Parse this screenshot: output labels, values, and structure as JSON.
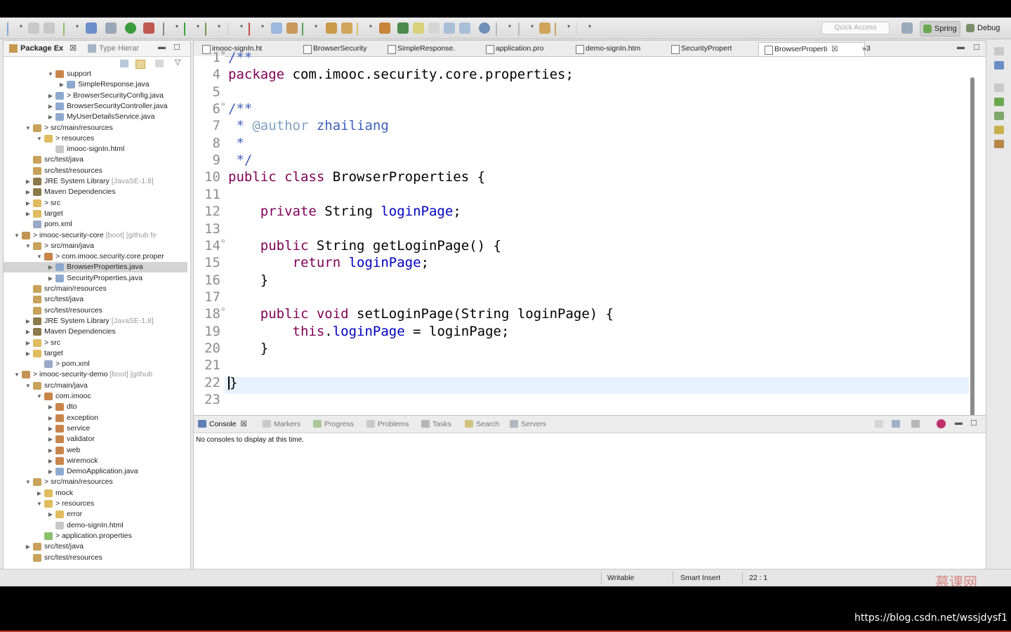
{
  "toolbar": {
    "quick_access_placeholder": "Quick Access",
    "perspectives": [
      {
        "label": "Spring",
        "icon": "spring-leaf-icon",
        "active": true
      },
      {
        "label": "Debug",
        "icon": "bug-icon",
        "active": false
      }
    ]
  },
  "left_panel": {
    "tabs": [
      {
        "label": "Package Ex",
        "icon": "package-explorer-icon",
        "closable": true,
        "active": true
      },
      {
        "label": "Type Hierar",
        "icon": "type-hierarchy-icon",
        "closable": false,
        "active": false
      }
    ],
    "tree": [
      {
        "indent": 4,
        "expanded": true,
        "icon": "package-icon",
        "label": "support"
      },
      {
        "indent": 5,
        "expanded": false,
        "icon": "java-file-icon",
        "label": "SimpleResponse.java"
      },
      {
        "indent": 4,
        "expanded": false,
        "icon": "java-file-icon",
        "label": "> BrowserSecurityConfig.java"
      },
      {
        "indent": 4,
        "expanded": false,
        "icon": "java-file-icon",
        "label": "BrowserSecurityController.java"
      },
      {
        "indent": 4,
        "expanded": false,
        "icon": "java-file-icon",
        "label": "MyUserDetailsService.java"
      },
      {
        "indent": 2,
        "expanded": true,
        "icon": "source-folder-icon",
        "label": "> src/main/resources"
      },
      {
        "indent": 3,
        "expanded": true,
        "icon": "folder-icon",
        "label": "> resources"
      },
      {
        "indent": 4,
        "expanded": null,
        "icon": "html-file-icon",
        "label": "imooc-signIn.html"
      },
      {
        "indent": 2,
        "expanded": null,
        "icon": "source-folder-icon",
        "label": "src/test/java"
      },
      {
        "indent": 2,
        "expanded": null,
        "icon": "source-folder-icon",
        "label": "src/test/resources"
      },
      {
        "indent": 2,
        "expanded": false,
        "icon": "library-icon",
        "label": "JRE System Library",
        "decoration": "[JavaSE-1.8]"
      },
      {
        "indent": 2,
        "expanded": false,
        "icon": "library-icon",
        "label": "Maven Dependencies"
      },
      {
        "indent": 2,
        "expanded": false,
        "icon": "folder-icon",
        "label": "> src"
      },
      {
        "indent": 2,
        "expanded": false,
        "icon": "folder-icon",
        "label": "target"
      },
      {
        "indent": 2,
        "expanded": null,
        "icon": "xml-file-icon",
        "label": "pom.xml"
      },
      {
        "indent": 1,
        "expanded": true,
        "icon": "project-icon",
        "label": "> imooc-security-core",
        "decoration": "[boot] [github fe"
      },
      {
        "indent": 2,
        "expanded": true,
        "icon": "source-folder-icon",
        "label": "> src/main/java"
      },
      {
        "indent": 3,
        "expanded": true,
        "icon": "package-icon",
        "label": "> com.imooc.security.core.proper"
      },
      {
        "indent": 4,
        "expanded": false,
        "icon": "java-file-icon",
        "label": "BrowserProperties.java",
        "selected": true
      },
      {
        "indent": 4,
        "expanded": false,
        "icon": "java-file-icon",
        "label": "SecurityProperties.java"
      },
      {
        "indent": 2,
        "expanded": null,
        "icon": "source-folder-icon",
        "label": "src/main/resources"
      },
      {
        "indent": 2,
        "expanded": null,
        "icon": "source-folder-icon",
        "label": "src/test/java"
      },
      {
        "indent": 2,
        "expanded": null,
        "icon": "source-folder-icon",
        "label": "src/test/resources"
      },
      {
        "indent": 2,
        "expanded": false,
        "icon": "library-icon",
        "label": "JRE System Library",
        "decoration": "[JavaSE-1.8]"
      },
      {
        "indent": 2,
        "expanded": false,
        "icon": "library-icon",
        "label": "Maven Dependencies"
      },
      {
        "indent": 2,
        "expanded": false,
        "icon": "folder-icon",
        "label": "> src"
      },
      {
        "indent": 2,
        "expanded": false,
        "icon": "folder-icon",
        "label": "target"
      },
      {
        "indent": 3,
        "expanded": null,
        "icon": "xml-file-icon",
        "label": "> pom.xml"
      },
      {
        "indent": 1,
        "expanded": true,
        "icon": "project-icon",
        "label": "> imooc-security-demo",
        "decoration": "[boot] [github"
      },
      {
        "indent": 2,
        "expanded": true,
        "icon": "source-folder-icon",
        "label": "src/main/java"
      },
      {
        "indent": 3,
        "expanded": true,
        "icon": "package-icon",
        "label": "com.imooc"
      },
      {
        "indent": 4,
        "expanded": false,
        "icon": "package-icon",
        "label": "dto"
      },
      {
        "indent": 4,
        "expanded": false,
        "icon": "package-icon",
        "label": "exception"
      },
      {
        "indent": 4,
        "expanded": false,
        "icon": "package-icon",
        "label": "service"
      },
      {
        "indent": 4,
        "expanded": false,
        "icon": "package-icon",
        "label": "validator"
      },
      {
        "indent": 4,
        "expanded": false,
        "icon": "package-icon",
        "label": "web"
      },
      {
        "indent": 4,
        "expanded": false,
        "icon": "package-icon",
        "label": "wiremock"
      },
      {
        "indent": 4,
        "expanded": false,
        "icon": "java-file-icon",
        "label": "DemoApplication.java"
      },
      {
        "indent": 2,
        "expanded": true,
        "icon": "source-folder-icon",
        "label": "> src/main/resources"
      },
      {
        "indent": 3,
        "expanded": false,
        "icon": "folder-icon",
        "label": "mock"
      },
      {
        "indent": 3,
        "expanded": true,
        "icon": "folder-icon",
        "label": "> resources"
      },
      {
        "indent": 4,
        "expanded": false,
        "icon": "folder-icon",
        "label": "error"
      },
      {
        "indent": 4,
        "expanded": null,
        "icon": "html-file-icon",
        "label": "demo-signIn.html"
      },
      {
        "indent": 3,
        "expanded": null,
        "icon": "properties-file-icon",
        "label": "> application.properties"
      },
      {
        "indent": 2,
        "expanded": false,
        "icon": "source-folder-icon",
        "label": "src/test/java"
      },
      {
        "indent": 2,
        "expanded": null,
        "icon": "source-folder-icon",
        "label": "src/test/resources"
      }
    ]
  },
  "editor": {
    "tabs": [
      {
        "label": "imooc-signIn.ht",
        "active": false
      },
      {
        "label": "BrowserSecurity",
        "active": false
      },
      {
        "label": "SimpleResponse.",
        "active": false
      },
      {
        "label": "application.pro",
        "active": false
      },
      {
        "label": "demo-signIn.htm",
        "active": false
      },
      {
        "label": "SecurityPropert",
        "active": false
      },
      {
        "label": "BrowserProperti",
        "active": true,
        "closable": true
      }
    ],
    "overflow_label": "»3",
    "lines": [
      {
        "n": "1",
        "fold": "⊕",
        "html": "<span class='cm'>/**</span>"
      },
      {
        "n": "4",
        "html": "<span class='kw'>package</span> com.imooc.security.core.properties;"
      },
      {
        "n": "5",
        "html": ""
      },
      {
        "n": "6",
        "fold": "⊖",
        "html": "<span class='cm'>/**</span>"
      },
      {
        "n": "7",
        "html": "<span class='cm'> * </span><span class='tag'>@author</span><span class='cm'> zhailiang</span>"
      },
      {
        "n": "8",
        "html": "<span class='cm'> *</span>"
      },
      {
        "n": "9",
        "html": "<span class='cm'> */</span>"
      },
      {
        "n": "10",
        "html": "<span class='kw'>public class</span> BrowserProperties {"
      },
      {
        "n": "11",
        "html": ""
      },
      {
        "n": "12",
        "html": "    <span class='kw'>private</span> String <span class='fld'>loginPage</span>;"
      },
      {
        "n": "13",
        "html": ""
      },
      {
        "n": "14",
        "fold": "⊖",
        "html": "    <span class='kw'>public</span> String getLoginPage() {"
      },
      {
        "n": "15",
        "html": "        <span class='kw'>return</span> <span class='fld'>loginPage</span>;"
      },
      {
        "n": "16",
        "html": "    }"
      },
      {
        "n": "17",
        "html": ""
      },
      {
        "n": "18",
        "fold": "⊖",
        "html": "    <span class='kw'>public void</span> setLoginPage(String loginPage) {"
      },
      {
        "n": "19",
        "html": "        <span class='kw'>this</span>.<span class='fld'>loginPage</span> = loginPage;"
      },
      {
        "n": "20",
        "html": "    }"
      },
      {
        "n": "21",
        "html": ""
      },
      {
        "n": "22",
        "html": "<span class='caret'></span>}"
      },
      {
        "n": "23",
        "html": ""
      }
    ]
  },
  "console": {
    "tabs": [
      {
        "label": "Console",
        "icon": "console-icon",
        "active": true,
        "closable": true
      },
      {
        "label": "Markers",
        "icon": "markers-icon"
      },
      {
        "label": "Progress",
        "icon": "progress-icon"
      },
      {
        "label": "Problems",
        "icon": "problems-icon"
      },
      {
        "label": "Tasks",
        "icon": "tasks-icon"
      },
      {
        "label": "Search",
        "icon": "search-icon"
      },
      {
        "label": "Servers",
        "icon": "servers-icon"
      }
    ],
    "message": "No consoles to display at this time."
  },
  "status": {
    "writable": "Writable",
    "insert_mode": "Smart Insert",
    "position": "22 : 1"
  },
  "watermark": "慕课网",
  "url_overlay": "https://blog.csdn.net/wssjdysf1"
}
